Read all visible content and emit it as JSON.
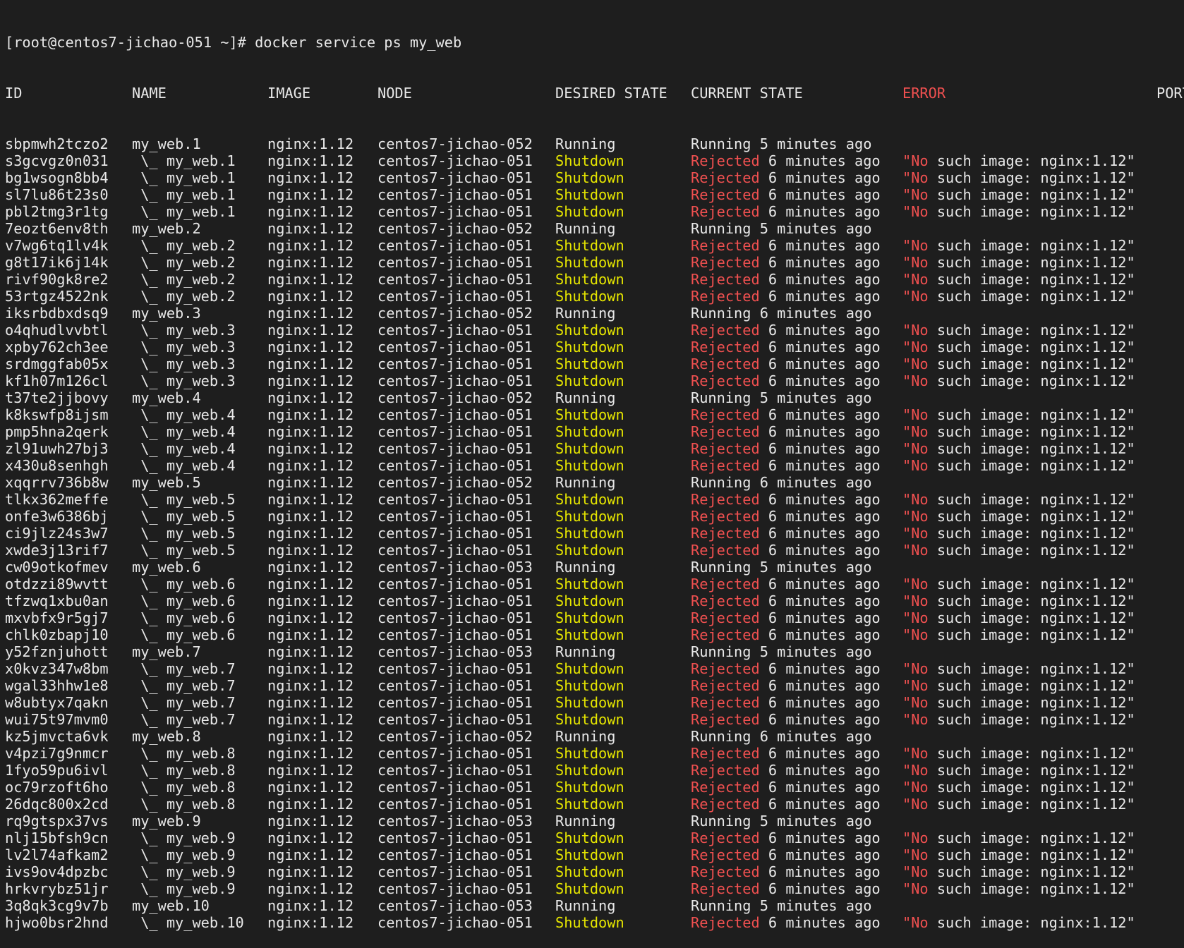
{
  "prompt": "[root@centos7-jichao-051 ~]# docker service ps my_web",
  "headers": {
    "id": "ID",
    "name": "NAME",
    "image": "IMAGE",
    "node": "NODE",
    "desired": "DESIRED STATE",
    "current": "CURRENT STATE",
    "error": "ERROR",
    "ports": "PORTS"
  },
  "colors": {
    "background": "#1e1e1e",
    "text": "#e8e8e8",
    "shutdown": "#e6e600",
    "rejected": "#f05050"
  },
  "rows": [
    {
      "id": "sbpmwh2tczo2",
      "name": "my_web.1",
      "image": "nginx:1.12",
      "node": "centos7-jichao-052",
      "desired": "Running",
      "state": "Running",
      "since": "5 minutes ago",
      "error": ""
    },
    {
      "id": "s3gcvgz0n031",
      "name": " \\_ my_web.1",
      "image": "nginx:1.12",
      "node": "centos7-jichao-051",
      "desired": "Shutdown",
      "state": "Rejected",
      "since": "6 minutes ago",
      "error": "\"No such image: nginx:1.12\""
    },
    {
      "id": "bg1wsogn8bb4",
      "name": " \\_ my_web.1",
      "image": "nginx:1.12",
      "node": "centos7-jichao-051",
      "desired": "Shutdown",
      "state": "Rejected",
      "since": "6 minutes ago",
      "error": "\"No such image: nginx:1.12\""
    },
    {
      "id": "sl7lu86t23s0",
      "name": " \\_ my_web.1",
      "image": "nginx:1.12",
      "node": "centos7-jichao-051",
      "desired": "Shutdown",
      "state": "Rejected",
      "since": "6 minutes ago",
      "error": "\"No such image: nginx:1.12\""
    },
    {
      "id": "pbl2tmg3r1tg",
      "name": " \\_ my_web.1",
      "image": "nginx:1.12",
      "node": "centos7-jichao-051",
      "desired": "Shutdown",
      "state": "Rejected",
      "since": "6 minutes ago",
      "error": "\"No such image: nginx:1.12\""
    },
    {
      "id": "7eozt6env8th",
      "name": "my_web.2",
      "image": "nginx:1.12",
      "node": "centos7-jichao-052",
      "desired": "Running",
      "state": "Running",
      "since": "5 minutes ago",
      "error": ""
    },
    {
      "id": "v7wg6tq1lv4k",
      "name": " \\_ my_web.2",
      "image": "nginx:1.12",
      "node": "centos7-jichao-051",
      "desired": "Shutdown",
      "state": "Rejected",
      "since": "6 minutes ago",
      "error": "\"No such image: nginx:1.12\""
    },
    {
      "id": "g8t17ik6j14k",
      "name": " \\_ my_web.2",
      "image": "nginx:1.12",
      "node": "centos7-jichao-051",
      "desired": "Shutdown",
      "state": "Rejected",
      "since": "6 minutes ago",
      "error": "\"No such image: nginx:1.12\""
    },
    {
      "id": "rivf90gk8re2",
      "name": " \\_ my_web.2",
      "image": "nginx:1.12",
      "node": "centos7-jichao-051",
      "desired": "Shutdown",
      "state": "Rejected",
      "since": "6 minutes ago",
      "error": "\"No such image: nginx:1.12\""
    },
    {
      "id": "53rtgz4522nk",
      "name": " \\_ my_web.2",
      "image": "nginx:1.12",
      "node": "centos7-jichao-051",
      "desired": "Shutdown",
      "state": "Rejected",
      "since": "6 minutes ago",
      "error": "\"No such image: nginx:1.12\""
    },
    {
      "id": "iksrbdbxdsq9",
      "name": "my_web.3",
      "image": "nginx:1.12",
      "node": "centos7-jichao-052",
      "desired": "Running",
      "state": "Running",
      "since": "6 minutes ago",
      "error": ""
    },
    {
      "id": "o4qhudlvvbtl",
      "name": " \\_ my_web.3",
      "image": "nginx:1.12",
      "node": "centos7-jichao-051",
      "desired": "Shutdown",
      "state": "Rejected",
      "since": "6 minutes ago",
      "error": "\"No such image: nginx:1.12\""
    },
    {
      "id": "xpby762ch3ee",
      "name": " \\_ my_web.3",
      "image": "nginx:1.12",
      "node": "centos7-jichao-051",
      "desired": "Shutdown",
      "state": "Rejected",
      "since": "6 minutes ago",
      "error": "\"No such image: nginx:1.12\""
    },
    {
      "id": "srdmggfab05x",
      "name": " \\_ my_web.3",
      "image": "nginx:1.12",
      "node": "centos7-jichao-051",
      "desired": "Shutdown",
      "state": "Rejected",
      "since": "6 minutes ago",
      "error": "\"No such image: nginx:1.12\""
    },
    {
      "id": "kf1h07m126cl",
      "name": " \\_ my_web.3",
      "image": "nginx:1.12",
      "node": "centos7-jichao-051",
      "desired": "Shutdown",
      "state": "Rejected",
      "since": "6 minutes ago",
      "error": "\"No such image: nginx:1.12\""
    },
    {
      "id": "t37te2jjbovy",
      "name": "my_web.4",
      "image": "nginx:1.12",
      "node": "centos7-jichao-052",
      "desired": "Running",
      "state": "Running",
      "since": "5 minutes ago",
      "error": ""
    },
    {
      "id": "k8kswfp8ijsm",
      "name": " \\_ my_web.4",
      "image": "nginx:1.12",
      "node": "centos7-jichao-051",
      "desired": "Shutdown",
      "state": "Rejected",
      "since": "6 minutes ago",
      "error": "\"No such image: nginx:1.12\""
    },
    {
      "id": "pmp5hna2qerk",
      "name": " \\_ my_web.4",
      "image": "nginx:1.12",
      "node": "centos7-jichao-051",
      "desired": "Shutdown",
      "state": "Rejected",
      "since": "6 minutes ago",
      "error": "\"No such image: nginx:1.12\""
    },
    {
      "id": "zl91uwh27bj3",
      "name": " \\_ my_web.4",
      "image": "nginx:1.12",
      "node": "centos7-jichao-051",
      "desired": "Shutdown",
      "state": "Rejected",
      "since": "6 minutes ago",
      "error": "\"No such image: nginx:1.12\""
    },
    {
      "id": "x430u8senhgh",
      "name": " \\_ my_web.4",
      "image": "nginx:1.12",
      "node": "centos7-jichao-051",
      "desired": "Shutdown",
      "state": "Rejected",
      "since": "6 minutes ago",
      "error": "\"No such image: nginx:1.12\""
    },
    {
      "id": "xqqrrv736b8w",
      "name": "my_web.5",
      "image": "nginx:1.12",
      "node": "centos7-jichao-052",
      "desired": "Running",
      "state": "Running",
      "since": "6 minutes ago",
      "error": ""
    },
    {
      "id": "tlkx362meffe",
      "name": " \\_ my_web.5",
      "image": "nginx:1.12",
      "node": "centos7-jichao-051",
      "desired": "Shutdown",
      "state": "Rejected",
      "since": "6 minutes ago",
      "error": "\"No such image: nginx:1.12\""
    },
    {
      "id": "onfe3w6386bj",
      "name": " \\_ my_web.5",
      "image": "nginx:1.12",
      "node": "centos7-jichao-051",
      "desired": "Shutdown",
      "state": "Rejected",
      "since": "6 minutes ago",
      "error": "\"No such image: nginx:1.12\""
    },
    {
      "id": "ci9jlz24s3w7",
      "name": " \\_ my_web.5",
      "image": "nginx:1.12",
      "node": "centos7-jichao-051",
      "desired": "Shutdown",
      "state": "Rejected",
      "since": "6 minutes ago",
      "error": "\"No such image: nginx:1.12\""
    },
    {
      "id": "xwde3j13rif7",
      "name": " \\_ my_web.5",
      "image": "nginx:1.12",
      "node": "centos7-jichao-051",
      "desired": "Shutdown",
      "state": "Rejected",
      "since": "6 minutes ago",
      "error": "\"No such image: nginx:1.12\""
    },
    {
      "id": "cw09otkofmev",
      "name": "my_web.6",
      "image": "nginx:1.12",
      "node": "centos7-jichao-053",
      "desired": "Running",
      "state": "Running",
      "since": "5 minutes ago",
      "error": ""
    },
    {
      "id": "otdzzi89wvtt",
      "name": " \\_ my_web.6",
      "image": "nginx:1.12",
      "node": "centos7-jichao-051",
      "desired": "Shutdown",
      "state": "Rejected",
      "since": "6 minutes ago",
      "error": "\"No such image: nginx:1.12\""
    },
    {
      "id": "tfzwq1xbu0an",
      "name": " \\_ my_web.6",
      "image": "nginx:1.12",
      "node": "centos7-jichao-051",
      "desired": "Shutdown",
      "state": "Rejected",
      "since": "6 minutes ago",
      "error": "\"No such image: nginx:1.12\""
    },
    {
      "id": "mxvbfx9r5gj7",
      "name": " \\_ my_web.6",
      "image": "nginx:1.12",
      "node": "centos7-jichao-051",
      "desired": "Shutdown",
      "state": "Rejected",
      "since": "6 minutes ago",
      "error": "\"No such image: nginx:1.12\""
    },
    {
      "id": "chlk0zbapj10",
      "name": " \\_ my_web.6",
      "image": "nginx:1.12",
      "node": "centos7-jichao-051",
      "desired": "Shutdown",
      "state": "Rejected",
      "since": "6 minutes ago",
      "error": "\"No such image: nginx:1.12\""
    },
    {
      "id": "y52fznjuhott",
      "name": "my_web.7",
      "image": "nginx:1.12",
      "node": "centos7-jichao-053",
      "desired": "Running",
      "state": "Running",
      "since": "5 minutes ago",
      "error": ""
    },
    {
      "id": "x0kvz347w8bm",
      "name": " \\_ my_web.7",
      "image": "nginx:1.12",
      "node": "centos7-jichao-051",
      "desired": "Shutdown",
      "state": "Rejected",
      "since": "6 minutes ago",
      "error": "\"No such image: nginx:1.12\""
    },
    {
      "id": "wgal33hhw1e8",
      "name": " \\_ my_web.7",
      "image": "nginx:1.12",
      "node": "centos7-jichao-051",
      "desired": "Shutdown",
      "state": "Rejected",
      "since": "6 minutes ago",
      "error": "\"No such image: nginx:1.12\""
    },
    {
      "id": "w8ubtyx7qakn",
      "name": " \\_ my_web.7",
      "image": "nginx:1.12",
      "node": "centos7-jichao-051",
      "desired": "Shutdown",
      "state": "Rejected",
      "since": "6 minutes ago",
      "error": "\"No such image: nginx:1.12\""
    },
    {
      "id": "wui75t97mvm0",
      "name": " \\_ my_web.7",
      "image": "nginx:1.12",
      "node": "centos7-jichao-051",
      "desired": "Shutdown",
      "state": "Rejected",
      "since": "6 minutes ago",
      "error": "\"No such image: nginx:1.12\""
    },
    {
      "id": "kz5jmvcta6vk",
      "name": "my_web.8",
      "image": "nginx:1.12",
      "node": "centos7-jichao-052",
      "desired": "Running",
      "state": "Running",
      "since": "6 minutes ago",
      "error": ""
    },
    {
      "id": "v4pzi7g9nmcr",
      "name": " \\_ my_web.8",
      "image": "nginx:1.12",
      "node": "centos7-jichao-051",
      "desired": "Shutdown",
      "state": "Rejected",
      "since": "6 minutes ago",
      "error": "\"No such image: nginx:1.12\""
    },
    {
      "id": "1fyo59pu6ivl",
      "name": " \\_ my_web.8",
      "image": "nginx:1.12",
      "node": "centos7-jichao-051",
      "desired": "Shutdown",
      "state": "Rejected",
      "since": "6 minutes ago",
      "error": "\"No such image: nginx:1.12\""
    },
    {
      "id": "oc79rzoft6ho",
      "name": " \\_ my_web.8",
      "image": "nginx:1.12",
      "node": "centos7-jichao-051",
      "desired": "Shutdown",
      "state": "Rejected",
      "since": "6 minutes ago",
      "error": "\"No such image: nginx:1.12\""
    },
    {
      "id": "26dqc800x2cd",
      "name": " \\_ my_web.8",
      "image": "nginx:1.12",
      "node": "centos7-jichao-051",
      "desired": "Shutdown",
      "state": "Rejected",
      "since": "6 minutes ago",
      "error": "\"No such image: nginx:1.12\""
    },
    {
      "id": "rq9gtspx37vs",
      "name": "my_web.9",
      "image": "nginx:1.12",
      "node": "centos7-jichao-053",
      "desired": "Running",
      "state": "Running",
      "since": "5 minutes ago",
      "error": ""
    },
    {
      "id": "nlj15bfsh9cn",
      "name": " \\_ my_web.9",
      "image": "nginx:1.12",
      "node": "centos7-jichao-051",
      "desired": "Shutdown",
      "state": "Rejected",
      "since": "6 minutes ago",
      "error": "\"No such image: nginx:1.12\""
    },
    {
      "id": "lv2l74afkam2",
      "name": " \\_ my_web.9",
      "image": "nginx:1.12",
      "node": "centos7-jichao-051",
      "desired": "Shutdown",
      "state": "Rejected",
      "since": "6 minutes ago",
      "error": "\"No such image: nginx:1.12\""
    },
    {
      "id": "ivs9ov4dpzbc",
      "name": " \\_ my_web.9",
      "image": "nginx:1.12",
      "node": "centos7-jichao-051",
      "desired": "Shutdown",
      "state": "Rejected",
      "since": "6 minutes ago",
      "error": "\"No such image: nginx:1.12\""
    },
    {
      "id": "hrkvrybz51jr",
      "name": " \\_ my_web.9",
      "image": "nginx:1.12",
      "node": "centos7-jichao-051",
      "desired": "Shutdown",
      "state": "Rejected",
      "since": "6 minutes ago",
      "error": "\"No such image: nginx:1.12\""
    },
    {
      "id": "3q8qk3cg9v7b",
      "name": "my_web.10",
      "image": "nginx:1.12",
      "node": "centos7-jichao-053",
      "desired": "Running",
      "state": "Running",
      "since": "5 minutes ago",
      "error": ""
    },
    {
      "id": "hjwo0bsr2hnd",
      "name": " \\_ my_web.10",
      "image": "nginx:1.12",
      "node": "centos7-jichao-051",
      "desired": "Shutdown",
      "state": "Rejected",
      "since": "6 minutes ago",
      "error": "\"No such image: nginx:1.12\""
    }
  ]
}
